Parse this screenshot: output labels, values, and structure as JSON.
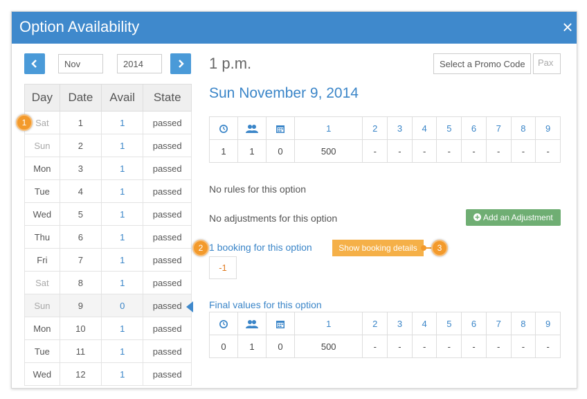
{
  "title": "Option Availability",
  "close_label": "×",
  "nav": {
    "month": "Nov",
    "year": "2014"
  },
  "promo_label": "Select a Promo Code",
  "pax_placeholder": "Pax",
  "selected_time": "1 p.m.",
  "selected_date": "Sun November 9, 2014",
  "days_table": {
    "headers": [
      "Day",
      "Date",
      "Avail",
      "State"
    ],
    "rows": [
      {
        "day": "Sat",
        "date": "1",
        "avail": "1",
        "state": "passed"
      },
      {
        "day": "Sun",
        "date": "2",
        "avail": "1",
        "state": "passed"
      },
      {
        "day": "Mon",
        "date": "3",
        "avail": "1",
        "state": "passed"
      },
      {
        "day": "Tue",
        "date": "4",
        "avail": "1",
        "state": "passed"
      },
      {
        "day": "Wed",
        "date": "5",
        "avail": "1",
        "state": "passed"
      },
      {
        "day": "Thu",
        "date": "6",
        "avail": "1",
        "state": "passed"
      },
      {
        "day": "Fri",
        "date": "7",
        "avail": "1",
        "state": "passed"
      },
      {
        "day": "Sat",
        "date": "8",
        "avail": "1",
        "state": "passed"
      },
      {
        "day": "Sun",
        "date": "9",
        "avail": "0",
        "state": "passed"
      },
      {
        "day": "Mon",
        "date": "10",
        "avail": "1",
        "state": "passed"
      },
      {
        "day": "Tue",
        "date": "11",
        "avail": "1",
        "state": "passed"
      },
      {
        "day": "Wed",
        "date": "12",
        "avail": "1",
        "state": "passed"
      }
    ]
  },
  "grid_headers": [
    "1",
    "2",
    "3",
    "4",
    "5",
    "6",
    "7",
    "8",
    "9"
  ],
  "option_values": [
    "1",
    "1",
    "0",
    "500",
    "-",
    "-",
    "-",
    "-",
    "-",
    "-",
    "-",
    "-"
  ],
  "final_values": [
    "0",
    "1",
    "0",
    "500",
    "-",
    "-",
    "-",
    "-",
    "-",
    "-",
    "-",
    "-"
  ],
  "no_rules_text": "No rules for this option",
  "no_adjustments_text": "No adjustments for this option",
  "add_adjustment_label": "Add an Adjustment",
  "booking_link": "1 booking for this option",
  "show_booking_label": "Show booking details",
  "booking_value": "-1",
  "final_values_label": "Final values for this option",
  "callouts": [
    "1",
    "2",
    "3"
  ],
  "colors": {
    "header": "#3f89cc",
    "link": "#3a85c8",
    "green_button": "#6fae73",
    "orange_button": "#f5b048",
    "callout": "#f39a2c"
  },
  "icons": [
    "clock-icon",
    "users-icon",
    "calendar-icon",
    "chevron-left-icon",
    "chevron-right-icon",
    "plus-circle-icon"
  ]
}
